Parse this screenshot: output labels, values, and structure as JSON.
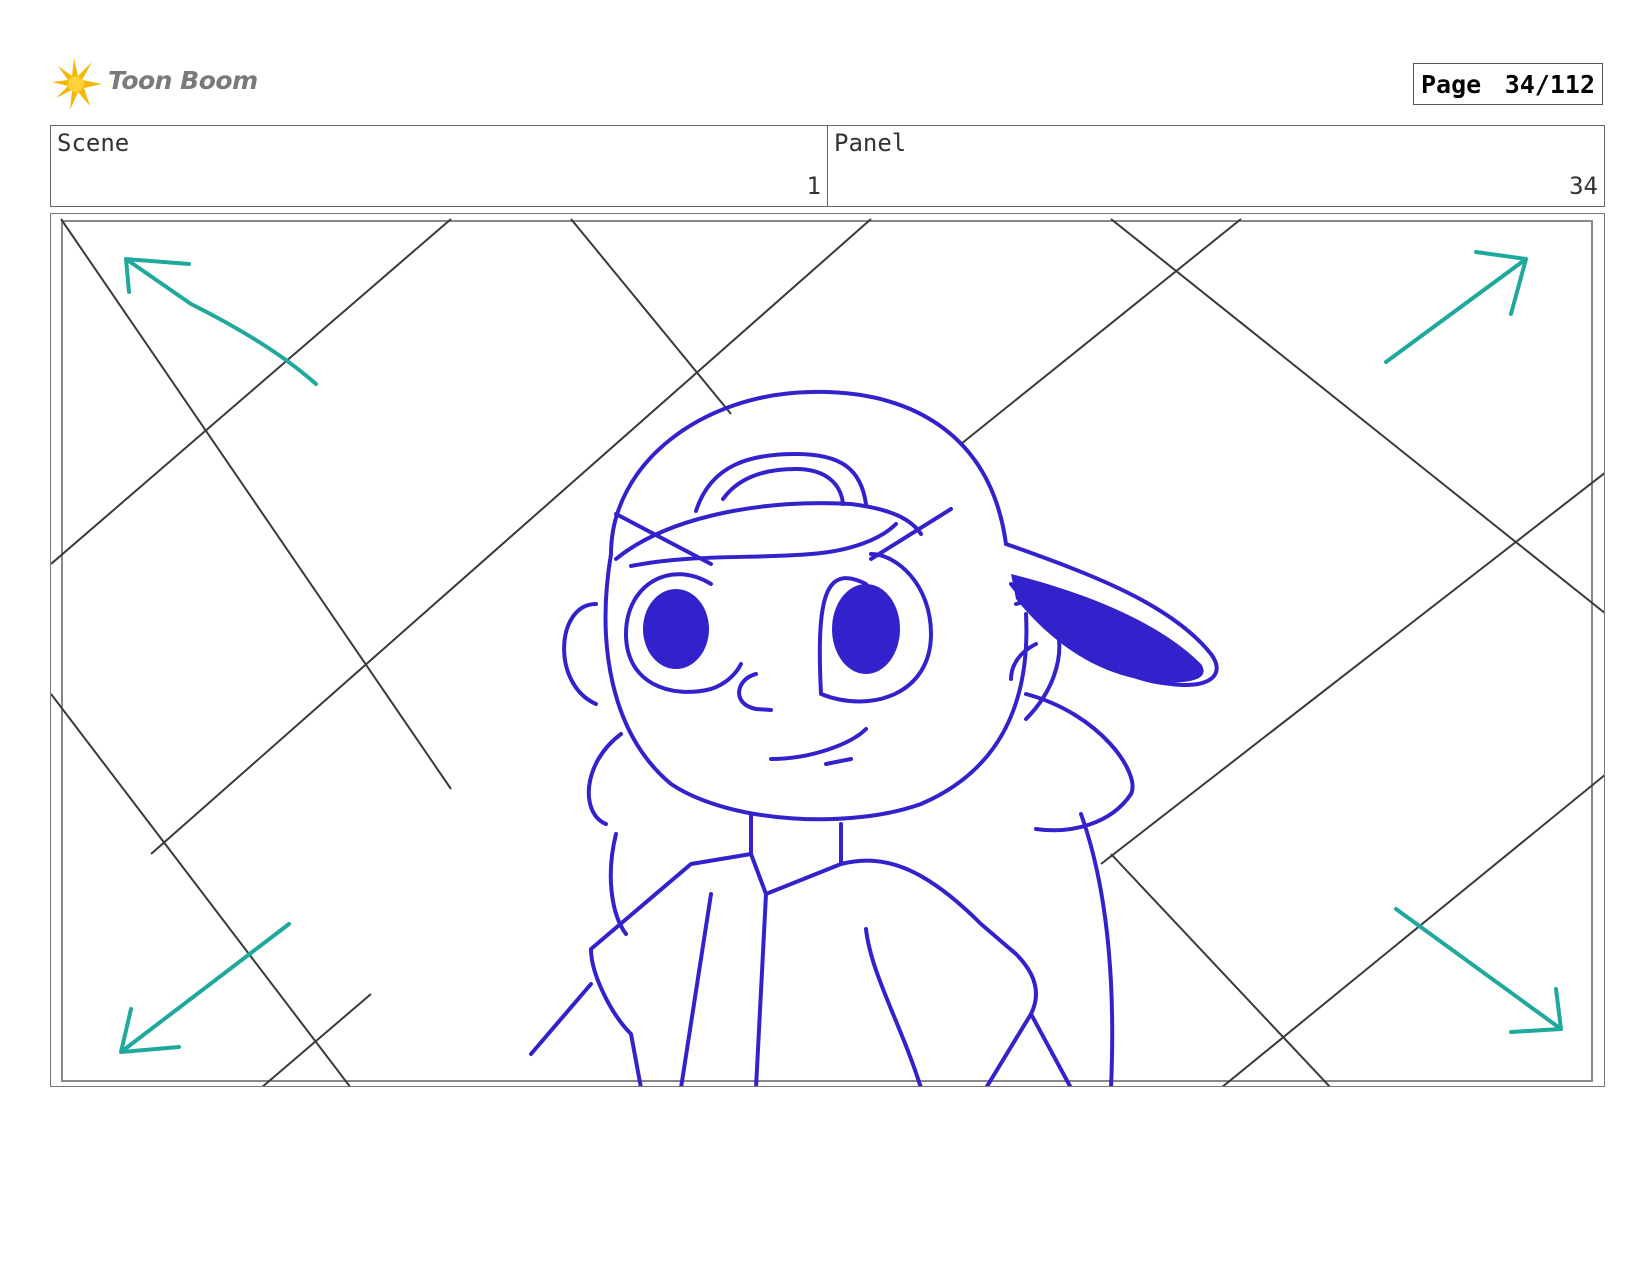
{
  "header": {
    "logo_text": "Toon Boom",
    "page_label": "Page",
    "page_value": "34/112"
  },
  "info": {
    "scene_label": "Scene",
    "scene_value": "1",
    "panel_label": "Panel",
    "panel_value": "34"
  },
  "colors": {
    "sketch": "#3322cc",
    "arrows": "#1fa89c",
    "lines": "#444444"
  }
}
